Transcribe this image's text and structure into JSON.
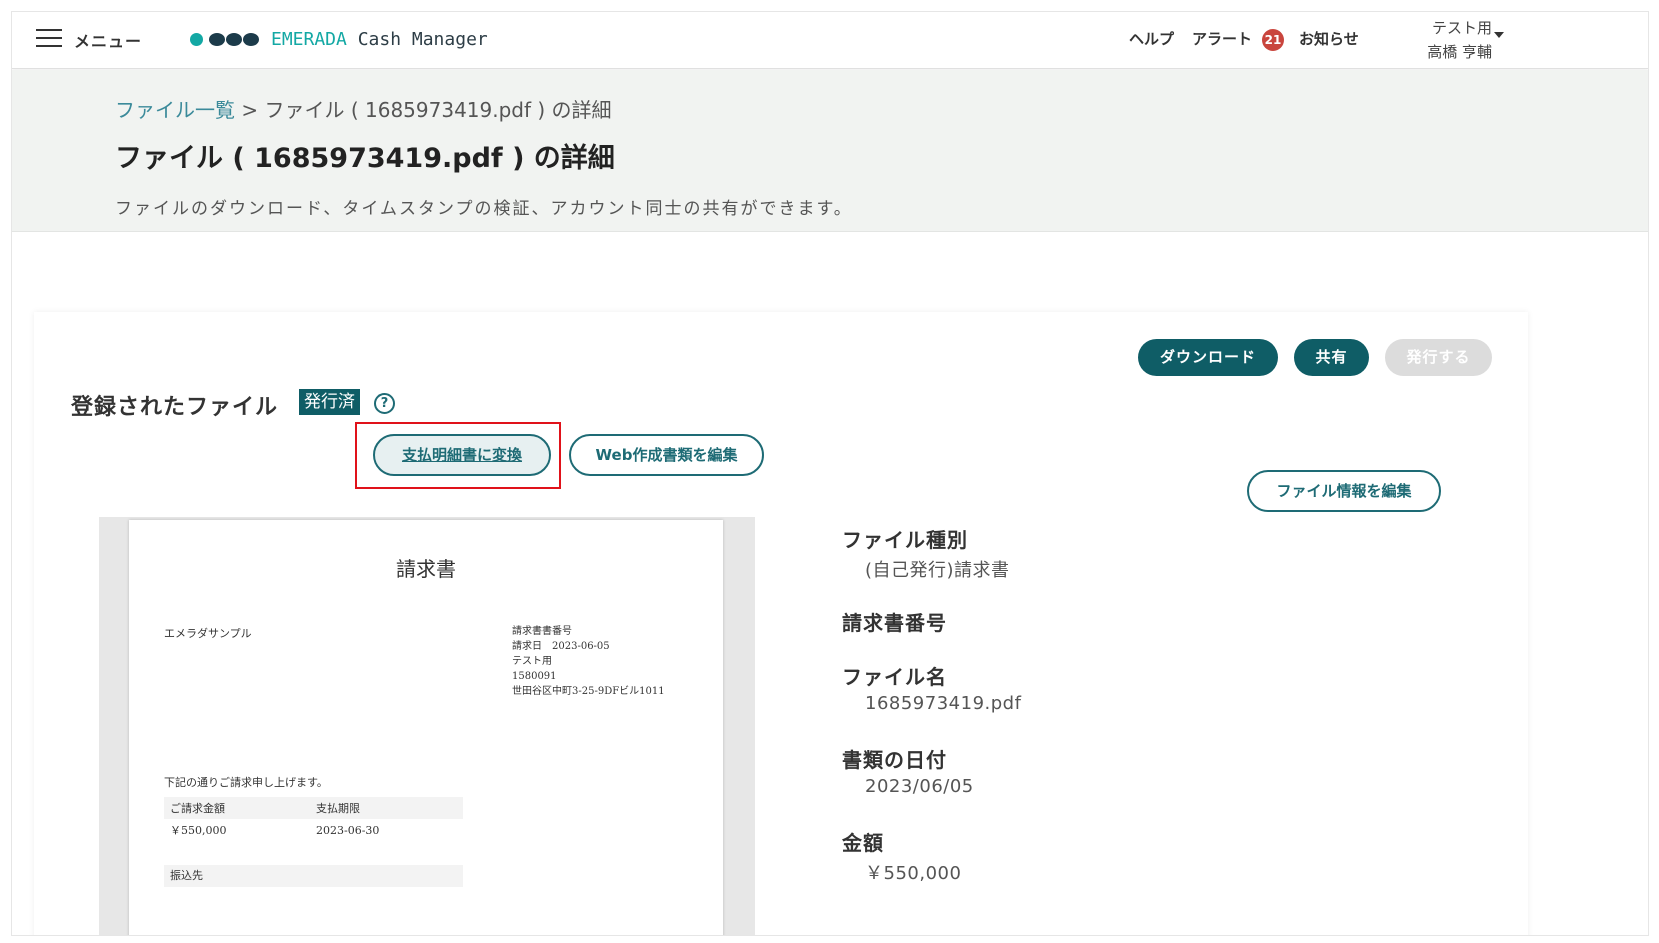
{
  "header": {
    "menu_label": "メニュー",
    "logo_brand": "EMERADA",
    "logo_product": "Cash Manager",
    "help": "ヘルプ",
    "alert": "アラート",
    "alert_count": "21",
    "notice": "お知らせ",
    "user_org": "テスト用",
    "user_name": "高橋 亨輔"
  },
  "breadcrumb": {
    "root": "ファイル一覧",
    "separator": " > ",
    "current": "ファイル ( 1685973419.pdf ) の詳細"
  },
  "page": {
    "title": "ファイル ( 1685973419.pdf ) の詳細",
    "description": "ファイルのダウンロード、タイムスタンプの検証、アカウント同士の共有ができます。"
  },
  "actions": {
    "download": "ダウンロード",
    "share": "共有",
    "issue": "発行する",
    "convert": "支払明細書に変換",
    "edit_web": "Web作成書類を編集",
    "edit_info": "ファイル情報を編集"
  },
  "section": {
    "title": "登録されたファイル",
    "status": "発行済",
    "help_glyph": "?"
  },
  "document": {
    "title": "請求書",
    "company": "エメラダサンプル",
    "meta_lines": [
      "請求書書番号",
      "請求日　2023-06-05",
      "テスト用",
      "1580091",
      "世田谷区中町3-25-9DFビル1011"
    ],
    "intro": "下記の通りご請求申し上げます。",
    "table_headers": [
      "ご請求金額",
      "支払期限"
    ],
    "table_values": [
      "￥550,000",
      "2023-06-30"
    ],
    "bank_label": "振込先"
  },
  "info": {
    "fields": [
      {
        "label": "ファイル種別",
        "value": "(自己発行)請求書"
      },
      {
        "label": "請求書番号",
        "value": ""
      },
      {
        "label": "ファイル名",
        "value": "1685973419.pdf"
      },
      {
        "label": "書類の日付",
        "value": "2023/06/05"
      },
      {
        "label": "金額",
        "value": "￥550,000"
      }
    ]
  },
  "colors": {
    "brand_teal": "#13a8a4",
    "primary": "#0f5d66",
    "alert_red": "#c9453d",
    "highlight_red": "#e0121a"
  }
}
